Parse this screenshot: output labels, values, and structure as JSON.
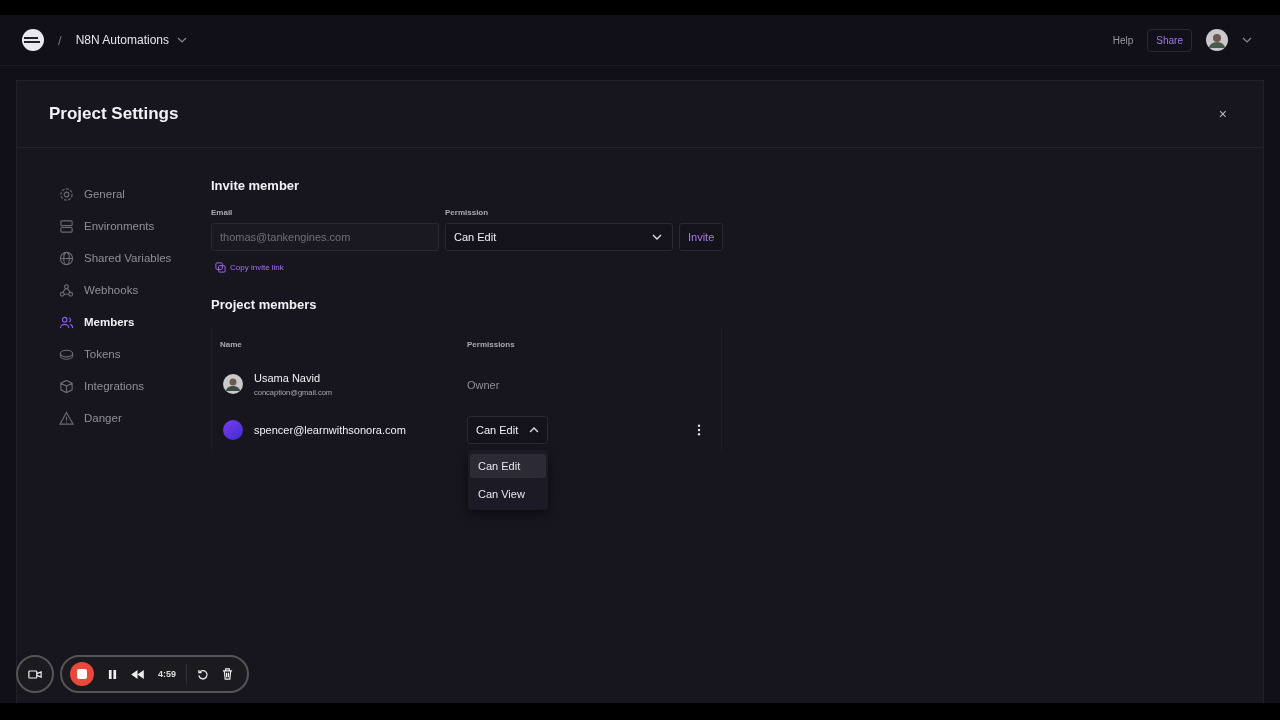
{
  "nav": {
    "separator": "/",
    "project": "N8N Automations",
    "help": "Help",
    "share": "Share"
  },
  "modal": {
    "title": "Project Settings",
    "close": "×"
  },
  "sidebar": [
    {
      "label": "General",
      "selected": false
    },
    {
      "label": "Environments",
      "selected": false
    },
    {
      "label": "Shared Variables",
      "selected": false
    },
    {
      "label": "Webhooks",
      "selected": false
    },
    {
      "label": "Members",
      "selected": true
    },
    {
      "label": "Tokens",
      "selected": false
    },
    {
      "label": "Integrations",
      "selected": false
    },
    {
      "label": "Danger",
      "selected": false
    }
  ],
  "invite": {
    "heading": "Invite member",
    "email_label": "Email",
    "email_placeholder": "thomas@tankengines.com",
    "permission_label": "Permission",
    "permission_value": "Can Edit",
    "button": "Invite",
    "copy_link": "Copy invite link"
  },
  "members": {
    "heading": "Project members",
    "columns": [
      "Name",
      "Permissions"
    ],
    "rows": [
      {
        "kind": "owner",
        "name": "Usama Navid",
        "email": "concaption@gmail.com",
        "permission": "Owner"
      },
      {
        "kind": "editable",
        "name": "spencer@learnwithsonora.com",
        "permission": "Can Edit",
        "expanded": true,
        "options": [
          {
            "label": "Can Edit",
            "selected": true
          },
          {
            "label": "Can View",
            "selected": false
          }
        ]
      }
    ]
  },
  "recorder": {
    "time": "4:59"
  }
}
